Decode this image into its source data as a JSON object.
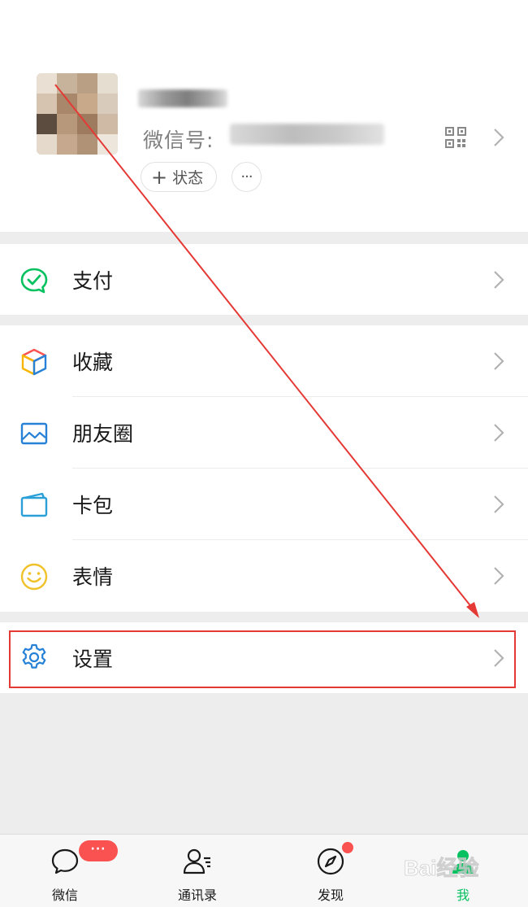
{
  "profile": {
    "wechat_id_label": "微信号:",
    "status_button_label": "状态",
    "status_plus": "+",
    "more_button_label": "···",
    "qr_icon": "qr-code-icon",
    "chevron_icon": "chevron-right-icon"
  },
  "menu": {
    "pay": {
      "label": "支付",
      "icon": "wechat-pay-icon",
      "color": "#07c160"
    },
    "favorites": {
      "label": "收藏",
      "icon": "favorites-cube-icon"
    },
    "moments": {
      "label": "朋友圈",
      "icon": "moments-photo-icon",
      "color": "#2782d7"
    },
    "cards": {
      "label": "卡包",
      "icon": "card-wallet-icon",
      "color": "#2a9fd8"
    },
    "stickers": {
      "label": "表情",
      "icon": "sticker-smile-icon",
      "color": "#f0c22a"
    },
    "settings": {
      "label": "设置",
      "icon": "settings-gear-icon",
      "color": "#2782d7"
    }
  },
  "tabs": [
    {
      "label": "微信",
      "icon": "chat-bubble-icon",
      "badge": "···"
    },
    {
      "label": "通讯录",
      "icon": "contacts-icon"
    },
    {
      "label": "发现",
      "icon": "compass-icon",
      "dot": true
    },
    {
      "label": "我",
      "icon": "me-person-icon",
      "active": true
    }
  ],
  "annotation": {
    "color": "#e53935",
    "highlighted_item": "设置"
  },
  "watermark": {
    "text": "Bai经验"
  },
  "colors": {
    "accent": "#07c160",
    "badge": "#fa5151",
    "background": "#ededed"
  }
}
